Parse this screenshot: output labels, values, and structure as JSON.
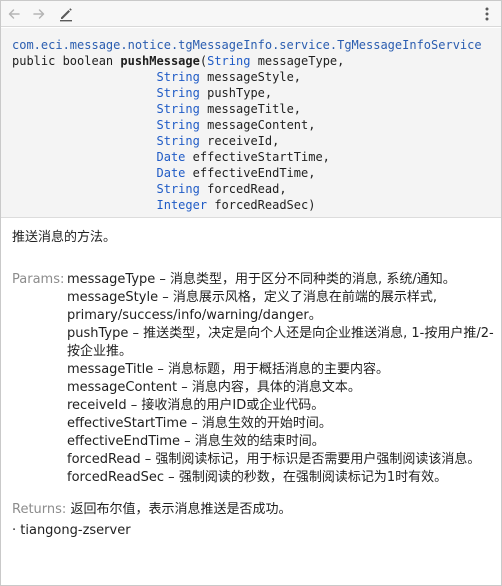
{
  "toolbar": {
    "back_icon": "arrow-left-icon",
    "forward_icon": "arrow-right-icon",
    "edit_icon": "pencil-icon",
    "more_icon": "vertical-dots-icon"
  },
  "signature": {
    "qualified_name": "com.eci.message.notice.tgMessageInfo.service.TgMessageInfoService",
    "modifiers": "public boolean ",
    "method_name": "pushMessage",
    "params": [
      {
        "type": "String",
        "name": "messageType,"
      },
      {
        "type": "String",
        "name": "messageStyle,"
      },
      {
        "type": "String",
        "name": "pushType,"
      },
      {
        "type": "String",
        "name": "messageTitle,"
      },
      {
        "type": "String",
        "name": "messageContent,"
      },
      {
        "type": "String",
        "name": "receiveId,"
      },
      {
        "type": "Date",
        "name": "effectiveStartTime,"
      },
      {
        "type": "Date",
        "name": "effectiveEndTime,"
      },
      {
        "type": "String",
        "name": "forcedRead,"
      },
      {
        "type": "Integer",
        "name": "forcedReadSec)"
      }
    ]
  },
  "description": "推送消息的方法。",
  "params_label": "Params:",
  "params": [
    "messageType – 消息类型，用于区分不同种类的消息, 系统/通知。",
    "messageStyle – 消息展示风格，定义了消息在前端的展示样式, primary/success/info/warning/danger。",
    "pushType – 推送类型，决定是向个人还是向企业推送消息, 1-按用户推/2-按企业推。",
    "messageTitle – 消息标题，用于概括消息的主要内容。",
    "messageContent – 消息内容，具体的消息文本。",
    "receiveId – 接收消息的用户ID或企业代码。",
    "effectiveStartTime – 消息生效的开始时间。",
    "effectiveEndTime – 消息生效的结束时间。",
    "forcedRead – 强制阅读标记，用于标识是否需要用户强制阅读该消息。",
    "forcedReadSec – 强制阅读的秒数，在强制阅读标记为1时有效。"
  ],
  "returns_label": "Returns:",
  "returns_text": "返回布尔值，表示消息推送是否成功。",
  "module": "· tiangong-zserver",
  "colors": {
    "qualified_name": "#2a5db0",
    "type_keyword": "#1f5bc6",
    "label_gray": "#8c8c8c",
    "signature_bg": "#f4f4f4"
  }
}
